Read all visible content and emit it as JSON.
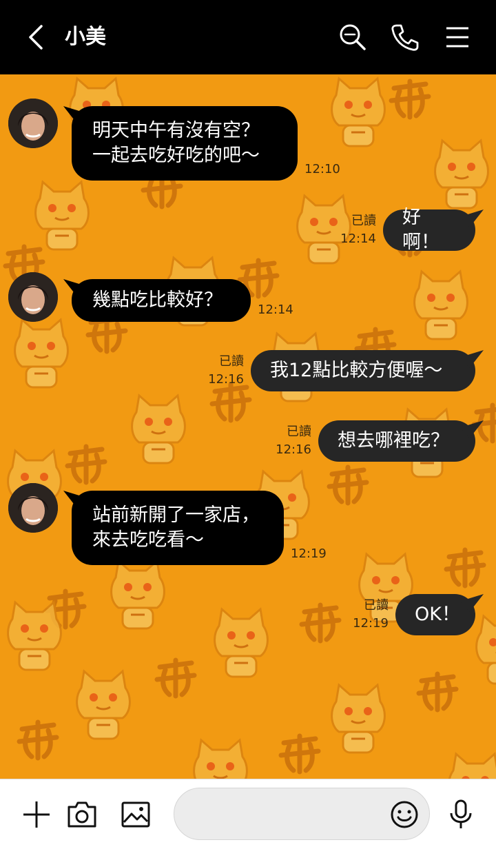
{
  "header": {
    "contact_name": "小美",
    "icons": [
      "back-chevron-icon",
      "search-icon",
      "phone-icon",
      "menu-icon"
    ]
  },
  "messages": [
    {
      "side": "in",
      "lines": [
        "明天中午有沒有空？",
        "一起去吃好吃的吧～"
      ],
      "time": "12:10"
    },
    {
      "side": "out",
      "text": "好啊！",
      "read": "已讀",
      "time": "12:14"
    },
    {
      "side": "in",
      "lines": [
        "幾點吃比較好？"
      ],
      "time": "12:14"
    },
    {
      "side": "out",
      "text": "我12點比較方便喔～",
      "read": "已讀",
      "time": "12:16"
    },
    {
      "side": "out",
      "text": "想去哪裡吃？",
      "read": "已讀",
      "time": "12:16"
    },
    {
      "side": "in",
      "lines": [
        "站前新開了一家店，",
        "來去吃吃看～"
      ],
      "time": "12:19"
    },
    {
      "side": "out",
      "text": "OK！",
      "read": "已讀",
      "time": "12:19"
    }
  ],
  "composer": {
    "placeholder": "",
    "icons": [
      "plus-icon",
      "camera-icon",
      "image-icon",
      "emoji-icon",
      "microphone-icon"
    ]
  },
  "colors": {
    "background": "#f29a12",
    "header": "#000000",
    "incoming_bubble": "#000000",
    "outgoing_bubble": "#262626"
  }
}
